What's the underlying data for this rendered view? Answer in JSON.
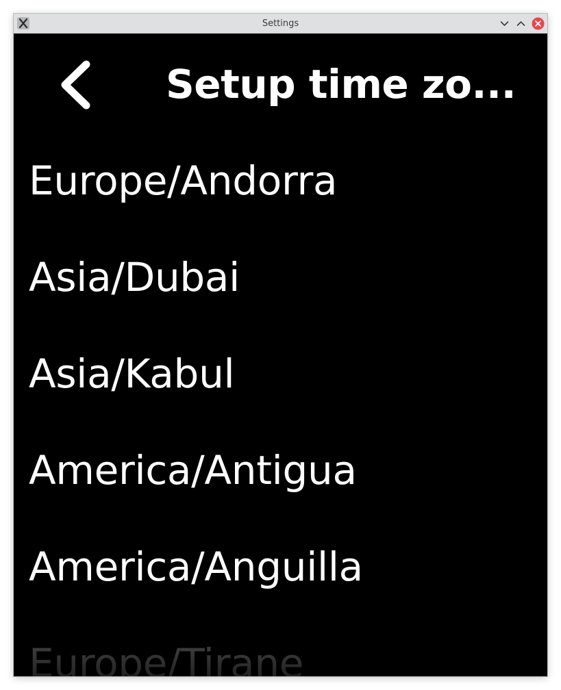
{
  "window": {
    "title": "Settings",
    "icons": {
      "app": "x-app-icon",
      "minimize": "chevron-down-icon",
      "maximize": "chevron-up-icon",
      "close": "close-icon"
    },
    "colors": {
      "titlebar": "#dee0e2",
      "close_button": "#e5484d",
      "background": "#000000"
    }
  },
  "header": {
    "back_icon": "chevron-left-icon",
    "title": "Setup time zo..."
  },
  "timezones": {
    "items": [
      {
        "label": "Europe/Andorra"
      },
      {
        "label": "Asia/Dubai"
      },
      {
        "label": "Asia/Kabul"
      },
      {
        "label": "America/Antigua"
      },
      {
        "label": "America/Anguilla"
      },
      {
        "label": "Europe/Tirane"
      }
    ]
  }
}
